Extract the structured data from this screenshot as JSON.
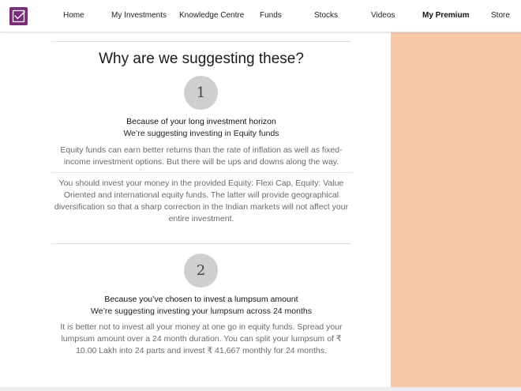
{
  "nav": {
    "items": [
      "Home",
      "My Investments",
      "Knowledge Centre",
      "Funds",
      "Stocks",
      "Videos",
      "My Premium",
      "Store"
    ],
    "active": "My Premium"
  },
  "colors": {
    "brand": "#7b2a7c",
    "accent_panel": "#f9c9a9",
    "step_circle": "#cfcfcf"
  },
  "content": {
    "heading": "Why are we suggesting these?",
    "reasons": [
      {
        "number": "1",
        "title": "Because of your long investment horizon",
        "subtitle": "We’re suggesting investing in Equity funds",
        "paragraphs": [
          "Equity funds can earn better returns than the rate of inflation as well as fixed-income investment options. But there will be ups and downs along the way.",
          "You should invest your money in the provided Equity: Flexi Cap, Equity: Value Oriented and international equity funds. The latter will provide geographical diversification so that a sharp correction in the Indian markets will not affect your entire investment."
        ]
      },
      {
        "number": "2",
        "title": "Because you’ve chosen to invest a lumpsum amount",
        "subtitle": "We’re suggesting investing your lumpsum across 24 months",
        "paragraphs": [
          "It is better not to invest all your money at one go in equity funds. Spread your lumpsum amount over a 24 month duration. You can split your lumpsum of ₹ 10.00 Lakh into 24 parts and invest ₹ 41,667 monthly for 24 months."
        ]
      }
    ]
  }
}
